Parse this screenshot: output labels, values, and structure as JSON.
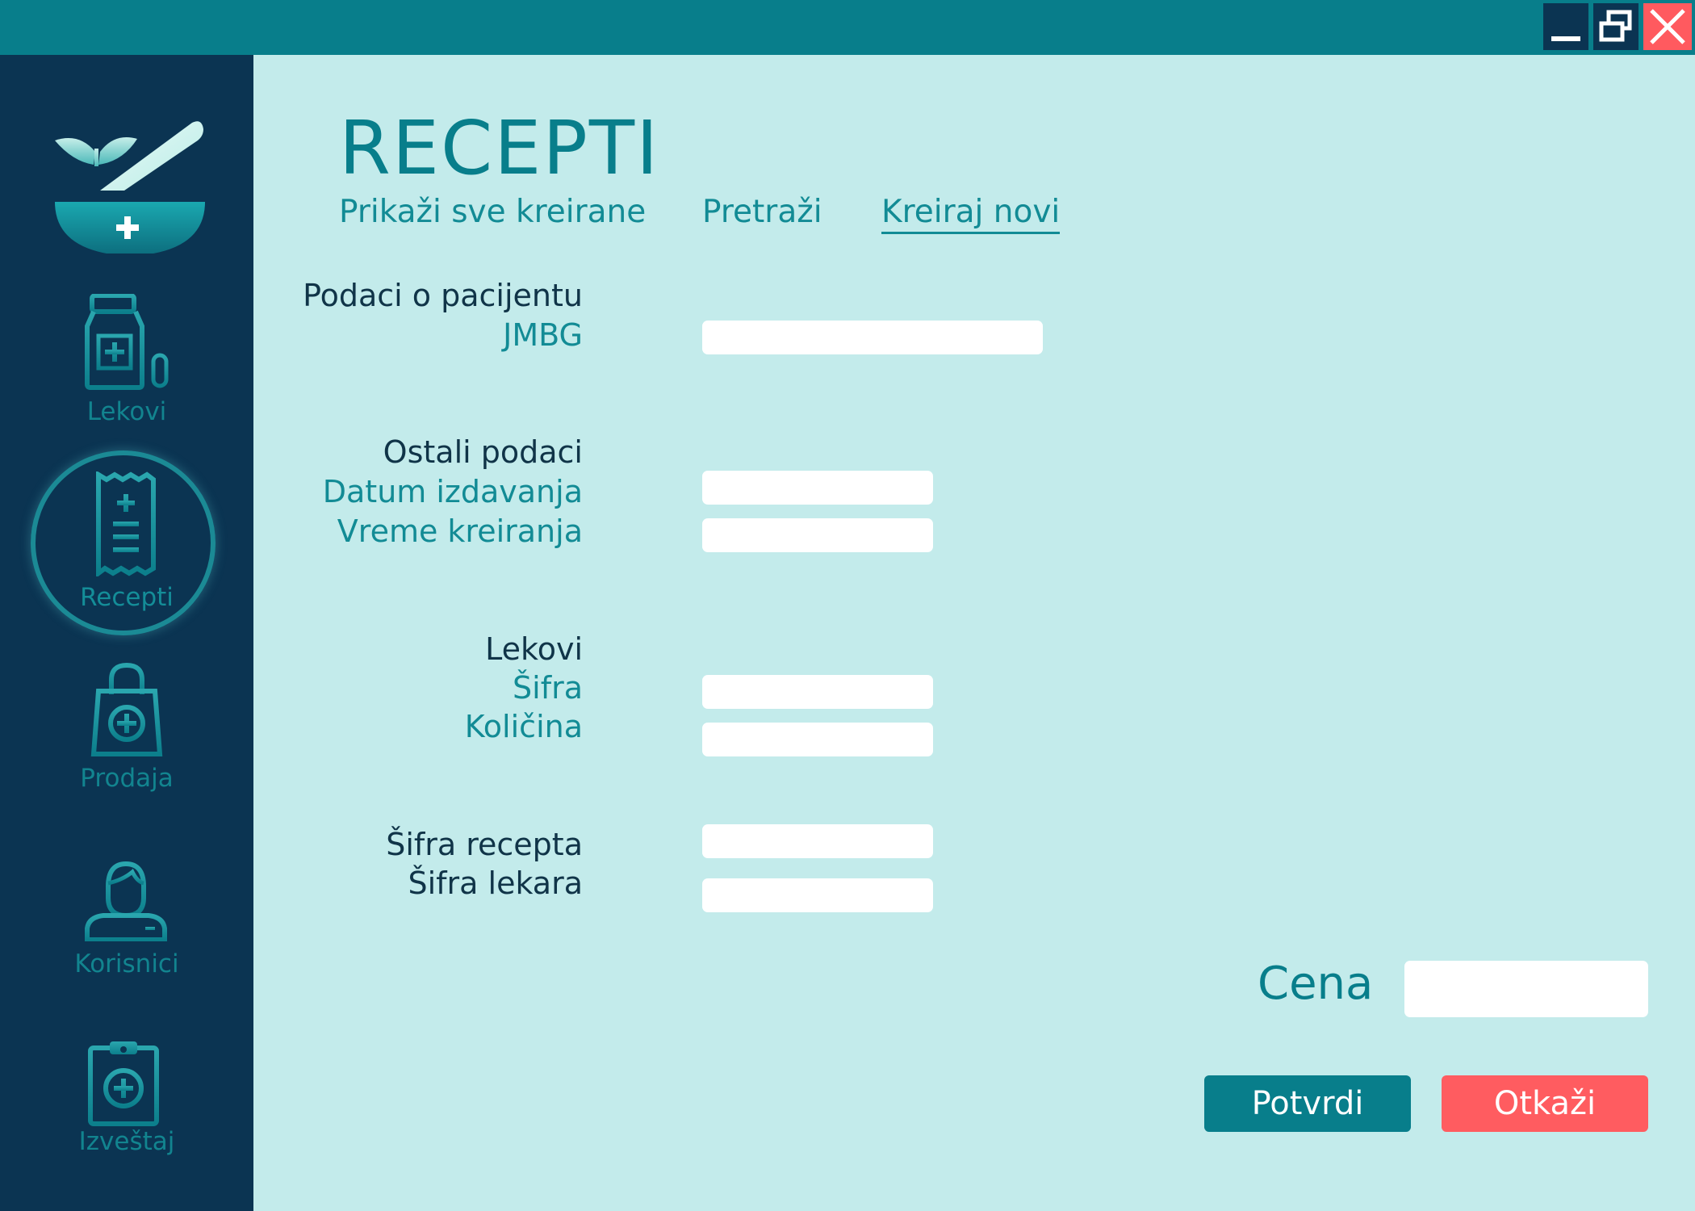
{
  "window": {
    "controls": [
      "minimize-icon",
      "restore-icon",
      "close-icon"
    ],
    "colors": {
      "titlebar": "#087e8b",
      "sidebar": "#0b3452",
      "content": "#c3ebeb",
      "cancel": "#ff5c60"
    }
  },
  "sidebar": {
    "logo": "mortar-pestle-icon",
    "items": [
      {
        "label": "Lekovi",
        "icon": "medicine-bottle-icon",
        "active": false
      },
      {
        "label": "Recepti",
        "icon": "receipt-icon",
        "active": true
      },
      {
        "label": "Prodaja",
        "icon": "shopping-bag-icon",
        "active": false
      },
      {
        "label": "Korisnici",
        "icon": "doctor-icon",
        "active": false
      },
      {
        "label": "Izveštaj",
        "icon": "clipboard-icon",
        "active": false
      }
    ]
  },
  "main": {
    "title": "RECEPTI",
    "tabs": [
      {
        "label": "Prikaži sve kreirane",
        "active": false
      },
      {
        "label": "Pretraži",
        "active": false
      },
      {
        "label": "Kreiraj novi",
        "active": true
      }
    ],
    "patient": {
      "section": "Podaci o pacijentu",
      "jmbg_label": "JMBG",
      "jmbg_value": ""
    },
    "other": {
      "section": "Ostali podaci",
      "issue_date_label": "Datum izdavanja",
      "issue_date_value": "",
      "created_time_label": "Vreme kreiranja",
      "created_time_value": ""
    },
    "drugs": {
      "section": "Lekovi",
      "code_label": "Šifra",
      "code_value": "",
      "quantity_label": "Količina",
      "quantity_value": ""
    },
    "ids": {
      "recipe_code_label": "Šifra recepta",
      "recipe_code_value": "",
      "doctor_code_label": "Šifra lekara",
      "doctor_code_value": ""
    },
    "price": {
      "label": "Cena",
      "value": ""
    },
    "buttons": {
      "confirm": "Potvrdi",
      "cancel": "Otkaži"
    }
  }
}
